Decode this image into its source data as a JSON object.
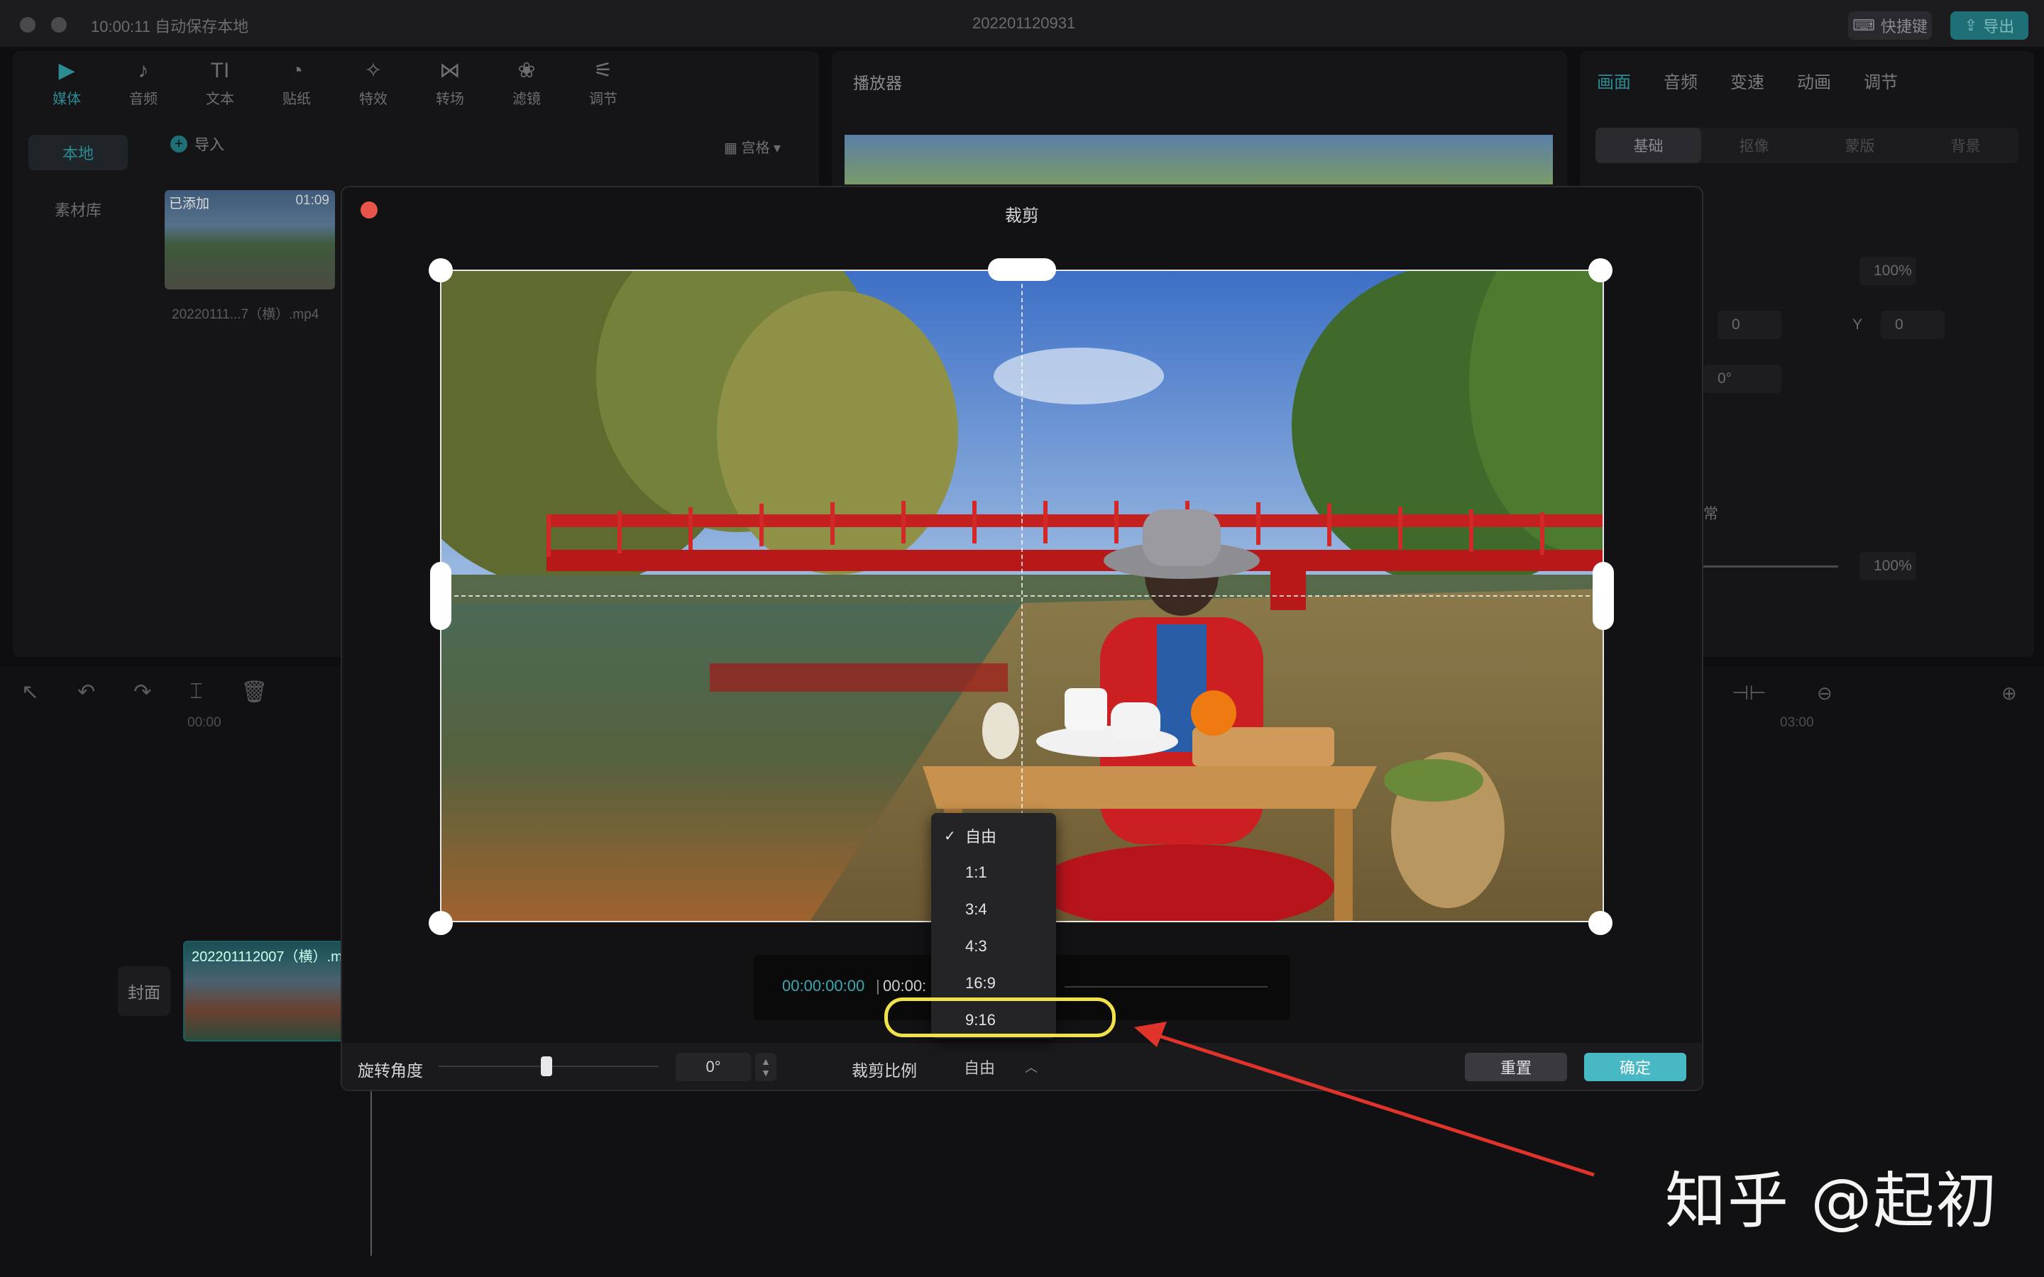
{
  "titlebar": {
    "time": "10:00:11 自动保存本地",
    "project": "202201120931",
    "shortcut_label": "快捷键",
    "export_label": "导出"
  },
  "media_panel": {
    "tabs": [
      {
        "label": "媒体",
        "icon": "media-icon",
        "glyph": "▶"
      },
      {
        "label": "音频",
        "icon": "audio-icon",
        "glyph": "♪"
      },
      {
        "label": "文本",
        "icon": "text-icon",
        "glyph": "TI"
      },
      {
        "label": "贴纸",
        "icon": "sticker-icon",
        "glyph": "◔"
      },
      {
        "label": "特效",
        "icon": "effects-icon",
        "glyph": "✧"
      },
      {
        "label": "转场",
        "icon": "transition-icon",
        "glyph": "⋈"
      },
      {
        "label": "滤镜",
        "icon": "filter-icon",
        "glyph": "❀"
      },
      {
        "label": "调节",
        "icon": "adjust-icon",
        "glyph": "⚟"
      }
    ],
    "side_nav": [
      "本地",
      "素材库"
    ],
    "import_label": "导入",
    "grid_label": "宫格",
    "clip": {
      "added": "已添加",
      "duration": "01:09",
      "name": "20220111...7（横）.mp4"
    }
  },
  "player": {
    "title": "播放器"
  },
  "props": {
    "tabs": [
      "画面",
      "音频",
      "变速",
      "动画",
      "调节"
    ],
    "subtabs": [
      "基础",
      "抠像",
      "蒙版",
      "背景"
    ],
    "scale": "100%",
    "pos_x": "0",
    "pos_y_label": "Y",
    "pos_y": "0",
    "rotate": "0°",
    "blend_label": "常",
    "opacity": "100%"
  },
  "timeline": {
    "ruler_start": "00:00",
    "ruler_end": "03:00",
    "cover_label": "封面",
    "track_clip_name": "202201112007（横）.m"
  },
  "crop_dialog": {
    "title": "裁剪",
    "time_current": "00:00:00:00",
    "time_sep": "|",
    "time_total": "00:00:",
    "rotation_label": "旋转角度",
    "rotation_value": "0°",
    "ratio_label": "裁剪比例",
    "ratio_value": "自由",
    "reset_label": "重置",
    "confirm_label": "确定",
    "ratio_options": [
      "自由",
      "1:1",
      "3:4",
      "4:3",
      "16:9",
      "9:16"
    ],
    "ratio_selected": "自由",
    "highlighted_option": "9:16"
  },
  "annotation": {
    "ring_color": "#f2e24a",
    "arrow_color": "#e0342a"
  },
  "watermark": "知乎 @起初",
  "colors": {
    "accent": "#2d8b93",
    "confirm": "#48b8c4",
    "close": "#e8534a"
  }
}
